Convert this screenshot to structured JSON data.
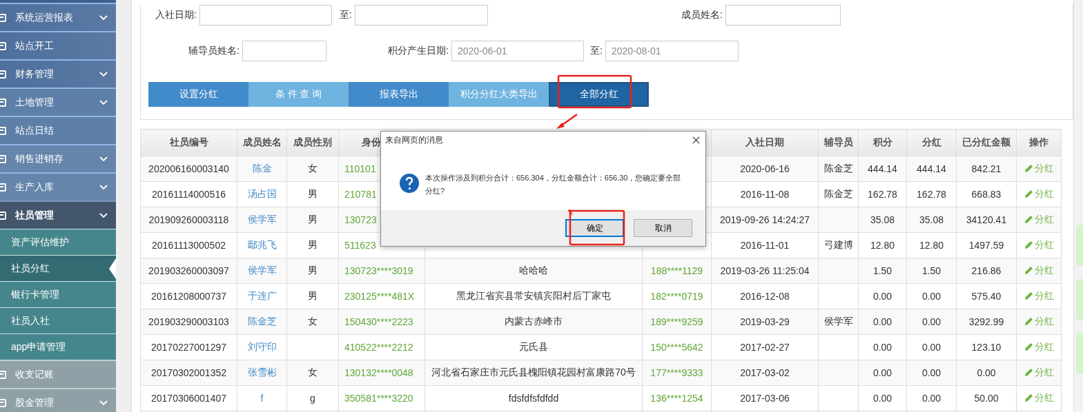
{
  "sidebar": {
    "items": [
      {
        "label": "系统运营报表",
        "has_submenu": true,
        "expanded": false,
        "kind": "primary"
      },
      {
        "label": "站点开工",
        "has_submenu": false,
        "expanded": false,
        "kind": "primary"
      },
      {
        "label": "财务管理",
        "has_submenu": true,
        "expanded": false,
        "kind": "primary"
      },
      {
        "label": "土地管理",
        "has_submenu": true,
        "expanded": false,
        "kind": "primary"
      },
      {
        "label": "站点日结",
        "has_submenu": false,
        "expanded": false,
        "kind": "primary"
      },
      {
        "label": "销售进销存",
        "has_submenu": true,
        "expanded": false,
        "kind": "primary"
      },
      {
        "label": "生产入库",
        "has_submenu": true,
        "expanded": false,
        "kind": "primary"
      },
      {
        "label": "社员管理",
        "has_submenu": true,
        "expanded": true,
        "kind": "primary",
        "children": [
          {
            "label": "资产评估维护",
            "selected": false
          },
          {
            "label": "社员分红",
            "selected": true
          },
          {
            "label": "银行卡管理",
            "selected": false
          },
          {
            "label": "社员入社",
            "selected": false
          },
          {
            "label": "app申请管理",
            "selected": false
          }
        ]
      },
      {
        "label": "收支记账",
        "has_submenu": false,
        "expanded": false,
        "kind": "secondary"
      },
      {
        "label": "股金管理",
        "has_submenu": true,
        "expanded": false,
        "kind": "secondary"
      }
    ]
  },
  "filters": [
    {
      "label": "入社日期:"
    },
    {
      "label": "至:"
    },
    {
      "label": "成员姓名:"
    },
    {
      "label": "辅导员姓名:"
    },
    {
      "label": "积分产生日期:",
      "value": "2020-06-01"
    },
    {
      "label": "至:",
      "value": "2020-08-01"
    }
  ],
  "buttons": [
    {
      "label": "设置分红",
      "color": "#428bca",
      "focused": false
    },
    {
      "label": "条 件 查 询",
      "color": "#6fb3e0",
      "focused": false
    },
    {
      "label": "报表导出",
      "color": "#428bca",
      "focused": false
    },
    {
      "label": "积分分红大类导出",
      "color": "#6fb3e0",
      "focused": false
    },
    {
      "label": "全部分红",
      "color": "#1f64a3",
      "focused": true
    }
  ],
  "table": {
    "columns": [
      "社员编号",
      "成员姓名",
      "成员性别",
      "身份",
      "入社日期",
      "辅导员",
      "积分",
      "分红",
      "已分红金额",
      "操作"
    ],
    "rows": [
      {
        "member_no": "202006160003140",
        "name": "陈金",
        "gender": "女",
        "id_card": "110101",
        "join_date": "2020-06-16",
        "mentor": "陈金芝",
        "points": "444.14",
        "dividend": "444.14",
        "paid": "842.21",
        "action": "分红"
      },
      {
        "member_no": "20161114000516",
        "name": "汤占国",
        "gender": "男",
        "id_card": "210781",
        "join_date": "2016-11-08",
        "mentor": "陈金芝",
        "points": "162.78",
        "dividend": "162.78",
        "paid": "668.83",
        "action": "分红"
      },
      {
        "member_no": "201909260003118",
        "name": "侯学军",
        "gender": "男",
        "id_card": "130723",
        "join_date": "2019-09-26 14:24:27",
        "points": "35.08",
        "dividend": "35.08",
        "paid": "34120.41",
        "action": "分红"
      },
      {
        "member_no": "20161113000502",
        "name": "鄢兆飞",
        "gender": "男",
        "id_card": "511623",
        "join_date": "2016-11-01",
        "mentor": "弓建博",
        "points": "12.80",
        "dividend": "12.80",
        "paid": "1497.59",
        "action": "分红"
      },
      {
        "member_no": "201903260003097",
        "name": "侯学军",
        "gender": "男",
        "id_card": "130723****3019",
        "address": "哈哈哈",
        "phone": "188****1129",
        "join_date": "2019-03-26 11:25:04",
        "points": "1.50",
        "dividend": "1.50",
        "paid": "216.86",
        "action": "分红"
      },
      {
        "member_no": "20161208000737",
        "name": "于连广",
        "gender": "男",
        "id_card": "230125****481X",
        "address": "黑龙江省宾县常安镇宾阳村后丁家屯",
        "phone": "182****0719",
        "join_date": "2016-12-08",
        "points": "0.00",
        "dividend": "0.00",
        "paid": "575.40",
        "action": "分红"
      },
      {
        "member_no": "201903290003103",
        "name": "陈金芝",
        "gender": "女",
        "id_card": "150430****2223",
        "address": "内蒙古赤峰市",
        "phone": "189****9259",
        "join_date": "2019-03-29",
        "mentor": "侯学军",
        "points": "0.00",
        "dividend": "0.00",
        "paid": "3292.99",
        "action": "分红"
      },
      {
        "member_no": "20170227001297",
        "name": "刘守印",
        "id_card": "410522****2212",
        "address": "元氏县",
        "phone": "150****5642",
        "join_date": "2017-02-27",
        "points": "0.00",
        "dividend": "0.00",
        "paid": "123.10",
        "action": "分红"
      },
      {
        "member_no": "20170302001352",
        "name": "张雪彬",
        "gender": "女",
        "id_card": "130132****0048",
        "address": "河北省石家庄市元氏县槐阳镇花园村富康路70号",
        "phone": "177****9333",
        "join_date": "2017-03-02",
        "points": "0.00",
        "dividend": "0.00",
        "paid": "0.00",
        "action": "分红"
      },
      {
        "member_no": "20170306001407",
        "name": "f",
        "gender": "g",
        "id_card": "350581****3220",
        "address": "fdsfdfsfdfdd",
        "phone": "136****1254",
        "join_date": "2017-03-06",
        "points": "0.00",
        "dividend": "0.00",
        "paid": "50.00",
        "action": "分红"
      }
    ]
  },
  "dialog": {
    "title": "来自网页的消息",
    "message": "本次操作涉及到积分合计：656.304，分红金额合计：656.30，您确定要全部分红?",
    "buttons": [
      {
        "label": "确定",
        "focused": true
      },
      {
        "label": "取消",
        "focused": false
      }
    ]
  }
}
